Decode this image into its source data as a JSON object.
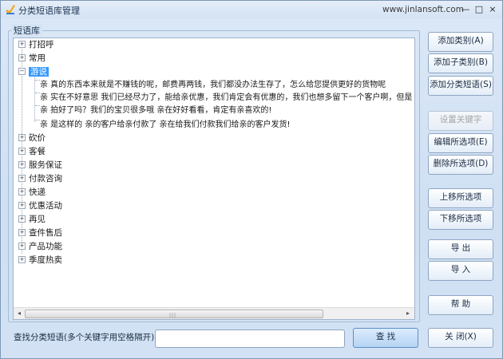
{
  "window": {
    "title": "分类短语库管理",
    "site": "www.jinlansoft.com",
    "minimize": "—",
    "maximize": "□",
    "close": "×"
  },
  "group_label": "短语库",
  "tree": {
    "categories_before": [
      "打招呼",
      "常用"
    ],
    "selected": "游说",
    "children": [
      "亲  真的东西本来就是不赚钱的呢，邮费再两钱，我们都没办法生存了，怎么给您提供更好的货物呢",
      "亲    实在不好意思  我们已经尽力了，能给亲优惠，我们肯定会有优惠的，我们也想多留下一个客户啊，但是    小本生意",
      "亲  拍好了吗？我们的宝贝很多哦  亲在好好看看，肯定有亲喜欢的!",
      "亲  是这样的  亲的客户给亲付款了  亲在给我们付款我们给亲的客户发货!"
    ],
    "categories_after": [
      "砍价",
      "客餐",
      "服务保证",
      "付款咨询",
      "快递",
      "优惠活动",
      "再见",
      "查件售后",
      "产品功能",
      "季度热卖"
    ]
  },
  "buttons": {
    "add_category": "添加类别(A)",
    "add_subcategory": "添加子类别(B)",
    "add_phrase": "添加分类短语(S)",
    "set_keyword": "设置关键字",
    "edit_selected": "编辑所选项(E)",
    "delete_selected": "删除所选项(D)",
    "move_up": "上移所选项",
    "move_down": "下移所选项",
    "export": "导  出",
    "import": "导  入",
    "help": "帮  助",
    "close": "关  闭(X)"
  },
  "search": {
    "label": "查找分类短语(多个关键字用空格隔开):",
    "value": "",
    "button": "查  找"
  },
  "icons": {
    "expand": "+",
    "collapse": "−",
    "scroll_left": "◂",
    "scroll_right": "▸"
  }
}
